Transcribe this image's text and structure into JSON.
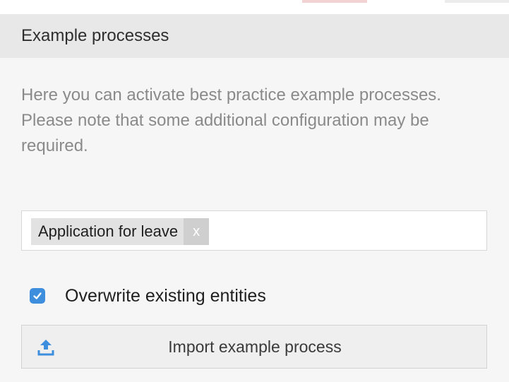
{
  "widget": {
    "title": "Example processes",
    "description": "Here you can activate best practice example processes. Please note that some additional configuration may be required."
  },
  "selected_processes": [
    {
      "label": "Application for leave",
      "remove_label": "x"
    }
  ],
  "overwrite_option": {
    "label": "Overwrite existing entities",
    "checked": true
  },
  "import_button": {
    "label": "Import example process",
    "icon": "upload-icon"
  },
  "colors": {
    "checkbox_accent": "#3e8ede",
    "icon_accent": "#3e8ede"
  }
}
